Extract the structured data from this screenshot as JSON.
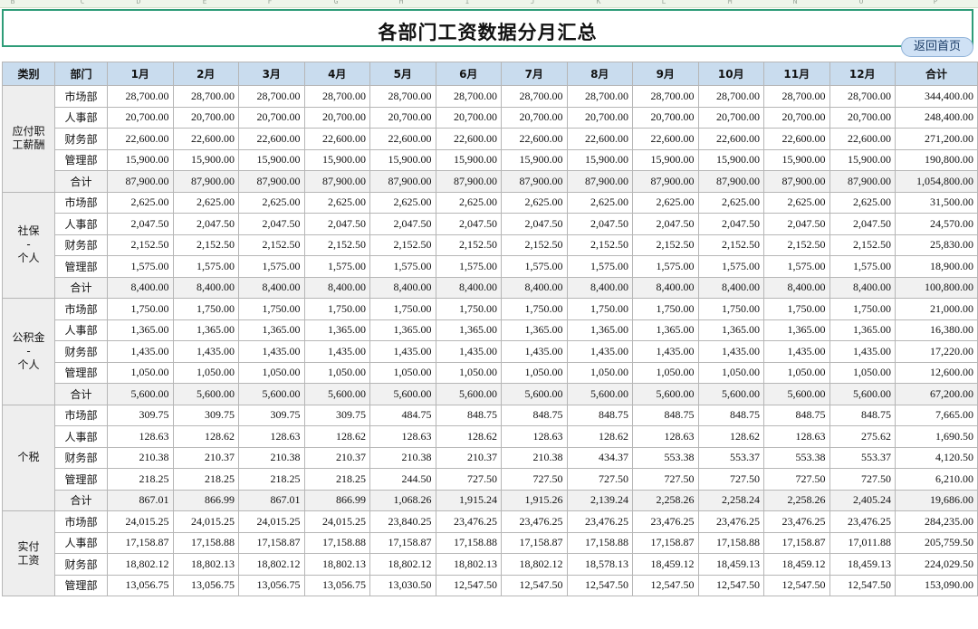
{
  "column_letters": [
    "B",
    "C",
    "D",
    "E",
    "F",
    "G",
    "H",
    "I",
    "J",
    "K",
    "L",
    "M",
    "N",
    "O",
    "P"
  ],
  "title": "各部门工资数据分月汇总",
  "back_button": "返回首页",
  "headers": [
    "类别",
    "部门",
    "1月",
    "2月",
    "3月",
    "4月",
    "5月",
    "6月",
    "7月",
    "8月",
    "9月",
    "10月",
    "11月",
    "12月",
    "合计"
  ],
  "groups": [
    {
      "category": [
        "应付职",
        "工薪酬"
      ],
      "rows": [
        {
          "dept": "市场部",
          "values": [
            "28,700.00",
            "28,700.00",
            "28,700.00",
            "28,700.00",
            "28,700.00",
            "28,700.00",
            "28,700.00",
            "28,700.00",
            "28,700.00",
            "28,700.00",
            "28,700.00",
            "28,700.00",
            "344,400.00"
          ]
        },
        {
          "dept": "人事部",
          "values": [
            "20,700.00",
            "20,700.00",
            "20,700.00",
            "20,700.00",
            "20,700.00",
            "20,700.00",
            "20,700.00",
            "20,700.00",
            "20,700.00",
            "20,700.00",
            "20,700.00",
            "20,700.00",
            "248,400.00"
          ]
        },
        {
          "dept": "财务部",
          "values": [
            "22,600.00",
            "22,600.00",
            "22,600.00",
            "22,600.00",
            "22,600.00",
            "22,600.00",
            "22,600.00",
            "22,600.00",
            "22,600.00",
            "22,600.00",
            "22,600.00",
            "22,600.00",
            "271,200.00"
          ]
        },
        {
          "dept": "管理部",
          "values": [
            "15,900.00",
            "15,900.00",
            "15,900.00",
            "15,900.00",
            "15,900.00",
            "15,900.00",
            "15,900.00",
            "15,900.00",
            "15,900.00",
            "15,900.00",
            "15,900.00",
            "15,900.00",
            "190,800.00"
          ]
        },
        {
          "dept": "合计",
          "total": true,
          "values": [
            "87,900.00",
            "87,900.00",
            "87,900.00",
            "87,900.00",
            "87,900.00",
            "87,900.00",
            "87,900.00",
            "87,900.00",
            "87,900.00",
            "87,900.00",
            "87,900.00",
            "87,900.00",
            "1,054,800.00"
          ]
        }
      ]
    },
    {
      "category": [
        "社保",
        "-",
        "个人"
      ],
      "rows": [
        {
          "dept": "市场部",
          "values": [
            "2,625.00",
            "2,625.00",
            "2,625.00",
            "2,625.00",
            "2,625.00",
            "2,625.00",
            "2,625.00",
            "2,625.00",
            "2,625.00",
            "2,625.00",
            "2,625.00",
            "2,625.00",
            "31,500.00"
          ]
        },
        {
          "dept": "人事部",
          "values": [
            "2,047.50",
            "2,047.50",
            "2,047.50",
            "2,047.50",
            "2,047.50",
            "2,047.50",
            "2,047.50",
            "2,047.50",
            "2,047.50",
            "2,047.50",
            "2,047.50",
            "2,047.50",
            "24,570.00"
          ]
        },
        {
          "dept": "财务部",
          "values": [
            "2,152.50",
            "2,152.50",
            "2,152.50",
            "2,152.50",
            "2,152.50",
            "2,152.50",
            "2,152.50",
            "2,152.50",
            "2,152.50",
            "2,152.50",
            "2,152.50",
            "2,152.50",
            "25,830.00"
          ]
        },
        {
          "dept": "管理部",
          "values": [
            "1,575.00",
            "1,575.00",
            "1,575.00",
            "1,575.00",
            "1,575.00",
            "1,575.00",
            "1,575.00",
            "1,575.00",
            "1,575.00",
            "1,575.00",
            "1,575.00",
            "1,575.00",
            "18,900.00"
          ]
        },
        {
          "dept": "合计",
          "total": true,
          "values": [
            "8,400.00",
            "8,400.00",
            "8,400.00",
            "8,400.00",
            "8,400.00",
            "8,400.00",
            "8,400.00",
            "8,400.00",
            "8,400.00",
            "8,400.00",
            "8,400.00",
            "8,400.00",
            "100,800.00"
          ]
        }
      ]
    },
    {
      "category": [
        "公积金",
        "-",
        "个人"
      ],
      "rows": [
        {
          "dept": "市场部",
          "values": [
            "1,750.00",
            "1,750.00",
            "1,750.00",
            "1,750.00",
            "1,750.00",
            "1,750.00",
            "1,750.00",
            "1,750.00",
            "1,750.00",
            "1,750.00",
            "1,750.00",
            "1,750.00",
            "21,000.00"
          ]
        },
        {
          "dept": "人事部",
          "values": [
            "1,365.00",
            "1,365.00",
            "1,365.00",
            "1,365.00",
            "1,365.00",
            "1,365.00",
            "1,365.00",
            "1,365.00",
            "1,365.00",
            "1,365.00",
            "1,365.00",
            "1,365.00",
            "16,380.00"
          ]
        },
        {
          "dept": "财务部",
          "values": [
            "1,435.00",
            "1,435.00",
            "1,435.00",
            "1,435.00",
            "1,435.00",
            "1,435.00",
            "1,435.00",
            "1,435.00",
            "1,435.00",
            "1,435.00",
            "1,435.00",
            "1,435.00",
            "17,220.00"
          ]
        },
        {
          "dept": "管理部",
          "values": [
            "1,050.00",
            "1,050.00",
            "1,050.00",
            "1,050.00",
            "1,050.00",
            "1,050.00",
            "1,050.00",
            "1,050.00",
            "1,050.00",
            "1,050.00",
            "1,050.00",
            "1,050.00",
            "12,600.00"
          ]
        },
        {
          "dept": "合计",
          "total": true,
          "values": [
            "5,600.00",
            "5,600.00",
            "5,600.00",
            "5,600.00",
            "5,600.00",
            "5,600.00",
            "5,600.00",
            "5,600.00",
            "5,600.00",
            "5,600.00",
            "5,600.00",
            "5,600.00",
            "67,200.00"
          ]
        }
      ]
    },
    {
      "category": [
        "个税"
      ],
      "rows": [
        {
          "dept": "市场部",
          "values": [
            "309.75",
            "309.75",
            "309.75",
            "309.75",
            "484.75",
            "848.75",
            "848.75",
            "848.75",
            "848.75",
            "848.75",
            "848.75",
            "848.75",
            "7,665.00"
          ]
        },
        {
          "dept": "人事部",
          "values": [
            "128.63",
            "128.62",
            "128.63",
            "128.62",
            "128.63",
            "128.62",
            "128.63",
            "128.62",
            "128.63",
            "128.62",
            "128.63",
            "275.62",
            "1,690.50"
          ]
        },
        {
          "dept": "财务部",
          "values": [
            "210.38",
            "210.37",
            "210.38",
            "210.37",
            "210.38",
            "210.37",
            "210.38",
            "434.37",
            "553.38",
            "553.37",
            "553.38",
            "553.37",
            "4,120.50"
          ]
        },
        {
          "dept": "管理部",
          "values": [
            "218.25",
            "218.25",
            "218.25",
            "218.25",
            "244.50",
            "727.50",
            "727.50",
            "727.50",
            "727.50",
            "727.50",
            "727.50",
            "727.50",
            "6,210.00"
          ]
        },
        {
          "dept": "合计",
          "total": true,
          "values": [
            "867.01",
            "866.99",
            "867.01",
            "866.99",
            "1,068.26",
            "1,915.24",
            "1,915.26",
            "2,139.24",
            "2,258.26",
            "2,258.24",
            "2,258.26",
            "2,405.24",
            "19,686.00"
          ]
        }
      ]
    },
    {
      "category": [
        "实付",
        "工资"
      ],
      "rows": [
        {
          "dept": "市场部",
          "values": [
            "24,015.25",
            "24,015.25",
            "24,015.25",
            "24,015.25",
            "23,840.25",
            "23,476.25",
            "23,476.25",
            "23,476.25",
            "23,476.25",
            "23,476.25",
            "23,476.25",
            "23,476.25",
            "284,235.00"
          ]
        },
        {
          "dept": "人事部",
          "values": [
            "17,158.87",
            "17,158.88",
            "17,158.87",
            "17,158.88",
            "17,158.87",
            "17,158.88",
            "17,158.87",
            "17,158.88",
            "17,158.87",
            "17,158.88",
            "17,158.87",
            "17,011.88",
            "205,759.50"
          ]
        },
        {
          "dept": "财务部",
          "values": [
            "18,802.12",
            "18,802.13",
            "18,802.12",
            "18,802.13",
            "18,802.12",
            "18,802.13",
            "18,802.12",
            "18,578.13",
            "18,459.12",
            "18,459.13",
            "18,459.12",
            "18,459.13",
            "224,029.50"
          ]
        },
        {
          "dept": "管理部",
          "values": [
            "13,056.75",
            "13,056.75",
            "13,056.75",
            "13,056.75",
            "13,030.50",
            "12,547.50",
            "12,547.50",
            "12,547.50",
            "12,547.50",
            "12,547.50",
            "12,547.50",
            "12,547.50",
            "153,090.00"
          ]
        }
      ]
    }
  ]
}
